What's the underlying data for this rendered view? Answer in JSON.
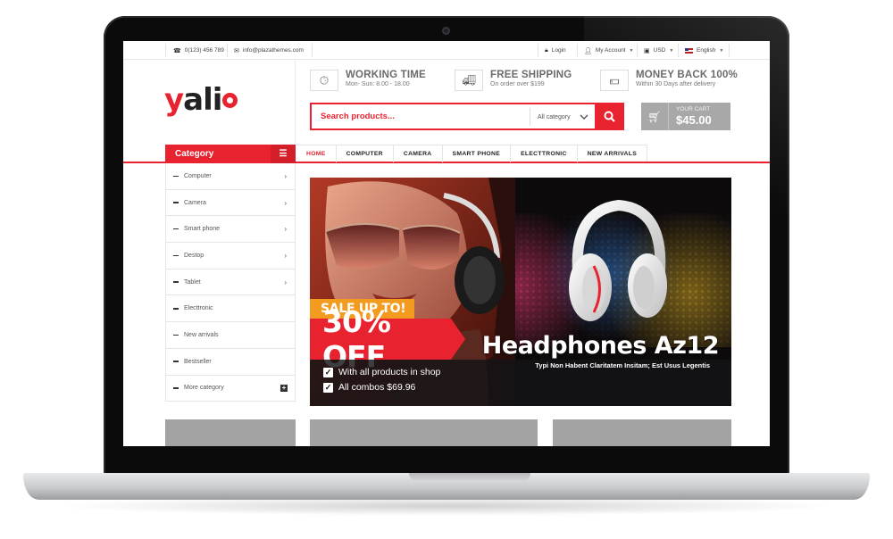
{
  "topbar": {
    "phone": "0(123) 456 789",
    "email": "info@plazathemes.com",
    "login": "Login",
    "account": "My Account",
    "currency": "USD",
    "language": "English"
  },
  "logo": {
    "part1": "y",
    "part2": "ali"
  },
  "features": [
    {
      "icon": "clock-icon",
      "title": "WORKING TIME",
      "subtitle": "Mon- Sun: 8.00 - 18.00"
    },
    {
      "icon": "truck-icon",
      "title": "FREE SHIPPING",
      "subtitle": "On order over $199"
    },
    {
      "icon": "money-icon",
      "title": "MONEY BACK 100%",
      "subtitle": "Within 30 Days after delivery"
    }
  ],
  "search": {
    "placeholder": "Search products...",
    "category": "All category"
  },
  "cart": {
    "label": "YOUR CART",
    "amount": "$45.00"
  },
  "category": {
    "title": "Category",
    "items": [
      {
        "label": "Computer",
        "arrow": true
      },
      {
        "label": "Camera",
        "arrow": true
      },
      {
        "label": "Smart phone",
        "arrow": true
      },
      {
        "label": "Destop",
        "arrow": true
      },
      {
        "label": "Tablet",
        "arrow": true
      },
      {
        "label": "Electtronic",
        "arrow": false
      },
      {
        "label": "New arrivals",
        "arrow": false
      },
      {
        "label": "Bestseller",
        "arrow": false
      },
      {
        "label": "More category",
        "plus": true
      }
    ]
  },
  "nav": {
    "items": [
      "HOME",
      "COMPUTER",
      "CAMERA",
      "SMART PHONE",
      "ELECTTRONIC",
      "NEW ARRIVALS"
    ],
    "active": "HOME"
  },
  "banner": {
    "sale": "SALE UP TO!",
    "off": "30% OFF",
    "check1": "With all products in shop",
    "check2": "All combos $69.96",
    "title": "Headphones Az12",
    "subtitle": "Typi Non Habent Claritatem Insitam; Est Usus Legentis"
  },
  "colors": {
    "accent": "#e8232f",
    "sale": "#f29b1e",
    "cart": "#a8a8a8"
  }
}
